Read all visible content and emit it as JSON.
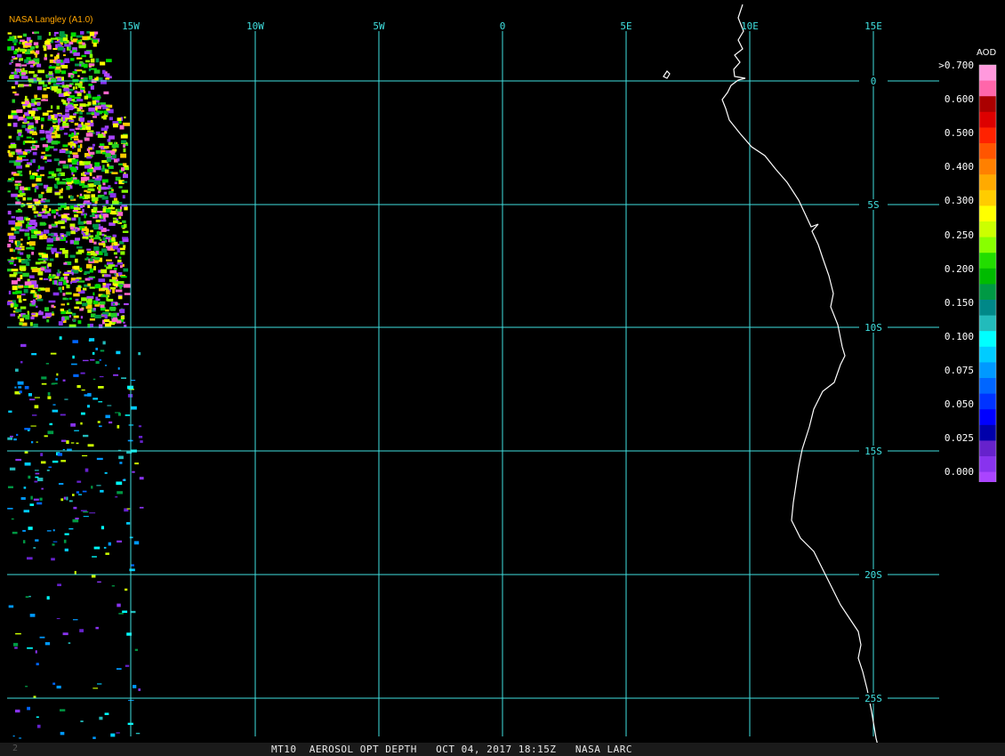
{
  "credit": "NASA Langley (A1.0)",
  "footer": {
    "title": "MT10  AEROSOL OPT DEPTH   OCT 04, 2017 18:15Z   NASA LARC",
    "mark": "2"
  },
  "map": {
    "lon_labels": [
      "15W",
      "10W",
      "5W",
      "0",
      "5E",
      "10E",
      "15E"
    ],
    "lat_labels": [
      "0",
      "5S",
      "10S",
      "15S",
      "20S",
      "25S"
    ],
    "grid_color": "#40e0e0",
    "coast_color": "#ffffff"
  },
  "legend": {
    "title": "AOD",
    "labels": [
      ">0.700",
      "0.600",
      "0.500",
      "0.400",
      "0.300",
      "0.250",
      "0.200",
      "0.150",
      "0.100",
      "0.075",
      "0.050",
      "0.025",
      "0.000"
    ],
    "colors": [
      "#ff99dd",
      "#ff66aa",
      "#aa0000",
      "#dd0000",
      "#ff2200",
      "#ff5500",
      "#ff8000",
      "#ffaa00",
      "#ffcc00",
      "#ffff00",
      "#ccff00",
      "#88ff00",
      "#22dd00",
      "#00bb00",
      "#009944",
      "#008888",
      "#22bbbb",
      "#00ffff",
      "#00ccff",
      "#0099ff",
      "#0066ff",
      "#0033ff",
      "#0000ff",
      "#0000aa",
      "#6622cc",
      "#8833ee",
      "#aa44ff"
    ]
  }
}
